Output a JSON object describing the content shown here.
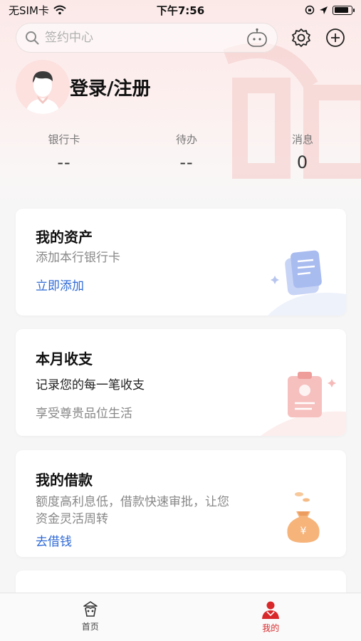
{
  "status_bar": {
    "carrier": "无SIM卡",
    "time": "下午7:56"
  },
  "search": {
    "placeholder": "签约中心"
  },
  "profile": {
    "login_label": "登录/注册"
  },
  "stats": [
    {
      "label": "银行卡",
      "value": "--"
    },
    {
      "label": "待办",
      "value": "--"
    },
    {
      "label": "消息",
      "value": "0"
    }
  ],
  "cards": {
    "assets": {
      "title": "我的资产",
      "subtitle": "添加本行银行卡",
      "link": "立即添加"
    },
    "monthly": {
      "title": "本月收支",
      "line": "记录您的每一笔收支",
      "subtitle": "享受尊贵品位生活"
    },
    "loan": {
      "title": "我的借款",
      "subtitle_1": "额度高利息低，借款快速审批，让您",
      "subtitle_2": "资金灵活周转",
      "link": "去借钱"
    }
  },
  "tabs": [
    {
      "label": "首页",
      "icon": "home-icon",
      "active": false
    },
    {
      "label": "我的",
      "icon": "person-icon",
      "active": true
    }
  ],
  "colors": {
    "accent": "#d8282a",
    "link": "#2f6ad6"
  }
}
